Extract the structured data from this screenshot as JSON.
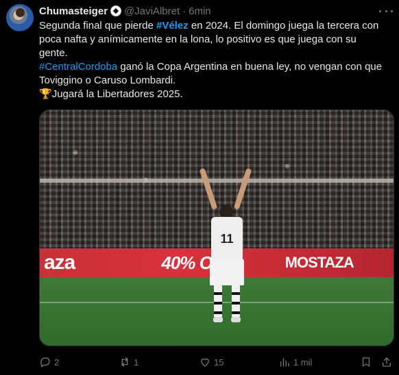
{
  "author": {
    "name": "Chumasteiger",
    "handle": "@JaviAlbret",
    "separator": "·",
    "time": "6min"
  },
  "tweet": {
    "line1": {
      "pre": "Segunda final que pierde ",
      "hashtag": "#Vélez",
      "post": " en 2024. El domingo juega la tercera con"
    },
    "line2": "poca nafta y anímicamente en la lona, lo positivo es que juega con su",
    "line3": "gente.",
    "line4": {
      "hashtag": "#CentralCordoba",
      "post": " ganó la Copa Argentina en buena ley, no vengan con que"
    },
    "line5": "Toviggino o Caruso Lombardi.",
    "line6": {
      "emoji": "🏆",
      "text": "Jugará la Libertadores 2025."
    }
  },
  "media": {
    "ad_text_1": "aza",
    "ad_text_2": "40% OFF",
    "ad_text_3": "MOSTAZA",
    "shirt_number": "11"
  },
  "actions": {
    "replies": "2",
    "reposts": "1",
    "likes": "15",
    "views": "1 mil"
  },
  "icons": {
    "badge": "soccer-ball-icon",
    "more": "more-options-icon",
    "reply": "reply-icon",
    "repost": "repost-icon",
    "like": "heart-icon",
    "views": "views-icon",
    "bookmark": "bookmark-icon",
    "share": "share-icon"
  }
}
